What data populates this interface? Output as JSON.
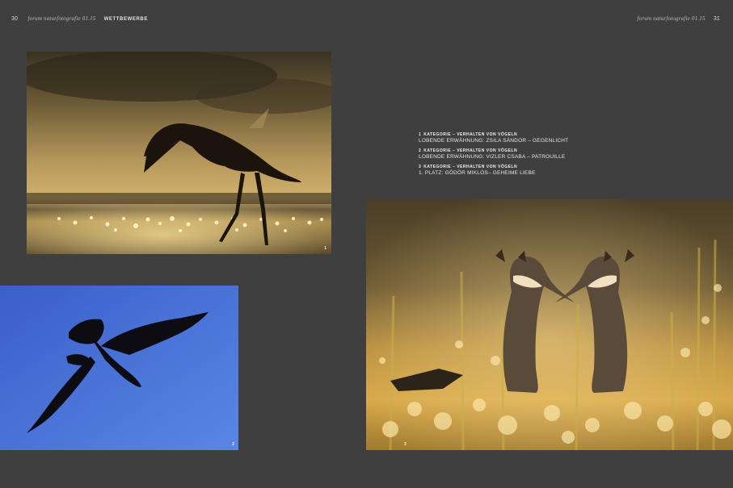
{
  "header": {
    "left_page_number": "30",
    "left_magazine": "forum naturfotografie 01.15",
    "section": "WETTBEWERBE",
    "right_magazine": "forum naturfotografie 01.15",
    "right_page_number": "31"
  },
  "photos": [
    {
      "number": "1"
    },
    {
      "number": "2"
    },
    {
      "number": "3"
    }
  ],
  "captions": [
    {
      "number": "1",
      "category": "KATEGORIE – VERHALTEN VON VÖGELN",
      "award": "LOBENDE ERWÄHNUNG: ZSILA SÁNDOR – GEGENLICHT"
    },
    {
      "number": "2",
      "category": "KATEGORIE – VERHALTEN VON VÖGELN",
      "award": "LOBENDE ERWÄHNUNG: VIZLER CSABA – PATROUILLE"
    },
    {
      "number": "3",
      "category": "KATEGORIE – VERHALTEN VON VÖGELN",
      "award": "1. PLATZ: GÖDÖR MIKLÓS– GEHEIME LIEBE"
    }
  ]
}
